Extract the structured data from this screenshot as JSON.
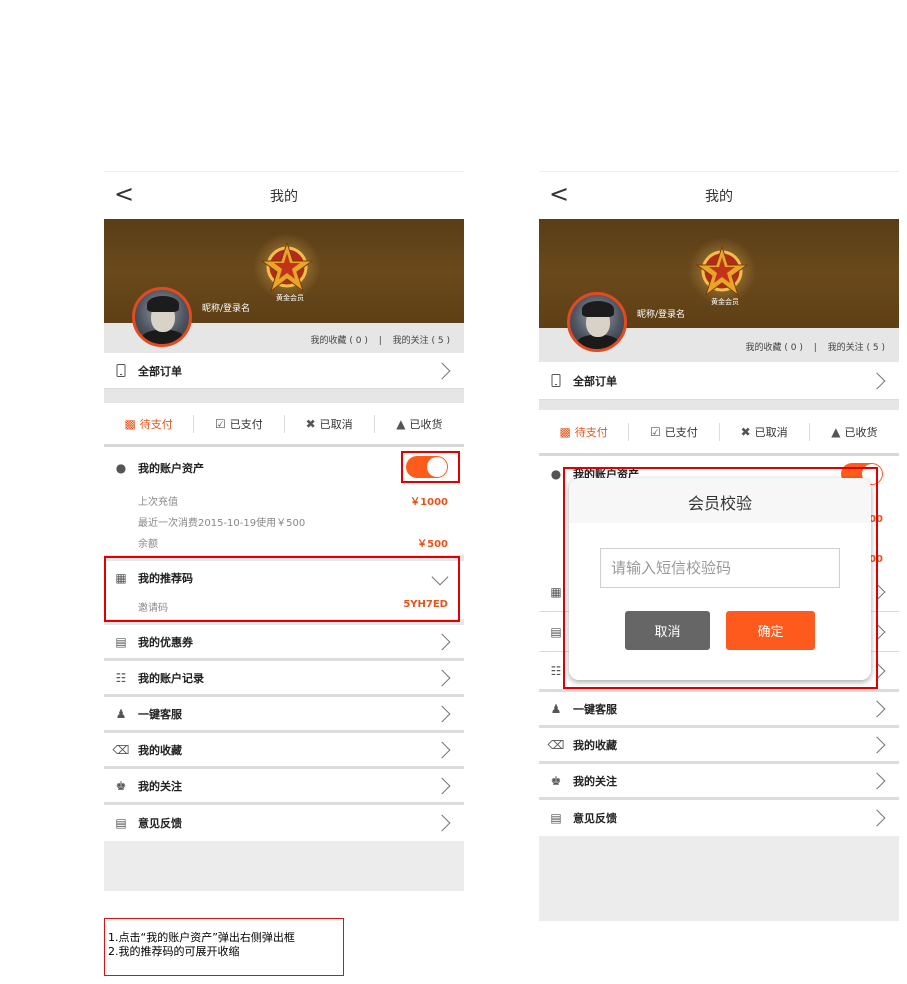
{
  "header": {
    "back_glyph": "<",
    "title": "我的"
  },
  "profile": {
    "nickname": "昵称/登录名",
    "vip_label": "黄金会员",
    "favorites": "我的收藏 ( 0 )",
    "separator": "|",
    "follows": "我的关注 ( 5 )"
  },
  "all_orders": "全部订单",
  "order_tabs": [
    {
      "label": "待支付",
      "icon": "wallet-icon",
      "active": true
    },
    {
      "label": "已支付",
      "icon": "checkbox-icon",
      "active": false
    },
    {
      "label": "已取消",
      "icon": "cancel-circle-icon",
      "active": false
    },
    {
      "label": "已收货",
      "icon": "thumb-up-icon",
      "active": false
    }
  ],
  "assets": {
    "title": "我的账户资产",
    "toggle_on": true,
    "last_recharge_label": "上次充值",
    "last_recharge_value": "￥1000",
    "last_spend": "最近一次消费2015-10-19使用￥500",
    "balance_label": "余额",
    "balance_value": "￥500"
  },
  "referral": {
    "title": "我的推荐码",
    "code_label": "邀请码",
    "code_value": "5YH7ED"
  },
  "menu": [
    {
      "label": "我的优惠券",
      "icon": "coupon-icon"
    },
    {
      "label": "我的账户记录",
      "icon": "notebook-icon"
    },
    {
      "label": "一键客服",
      "icon": "customer-service-icon"
    },
    {
      "label": "我的收藏",
      "icon": "cart-icon"
    },
    {
      "label": "我的关注",
      "icon": "crown-icon"
    },
    {
      "label": "意见反馈",
      "icon": "feedback-icon"
    }
  ],
  "right_menu": [
    {
      "label": "一键客服"
    },
    {
      "label": "我的收藏"
    },
    {
      "label": "我的关注"
    },
    {
      "label": "意见反馈"
    }
  ],
  "dialog": {
    "title": "会员校验",
    "input_placeholder": "请输入短信校验码",
    "cancel": "取消",
    "confirm": "确定"
  },
  "note": {
    "line1": "1.点击“我的账户资产”弹出右侧弹出框",
    "line2": "2.我的推荐码的可展开收缩"
  },
  "colors": {
    "accent": "#ff5a1d",
    "red_box": "#e10000",
    "banner": "#5a3d16"
  }
}
